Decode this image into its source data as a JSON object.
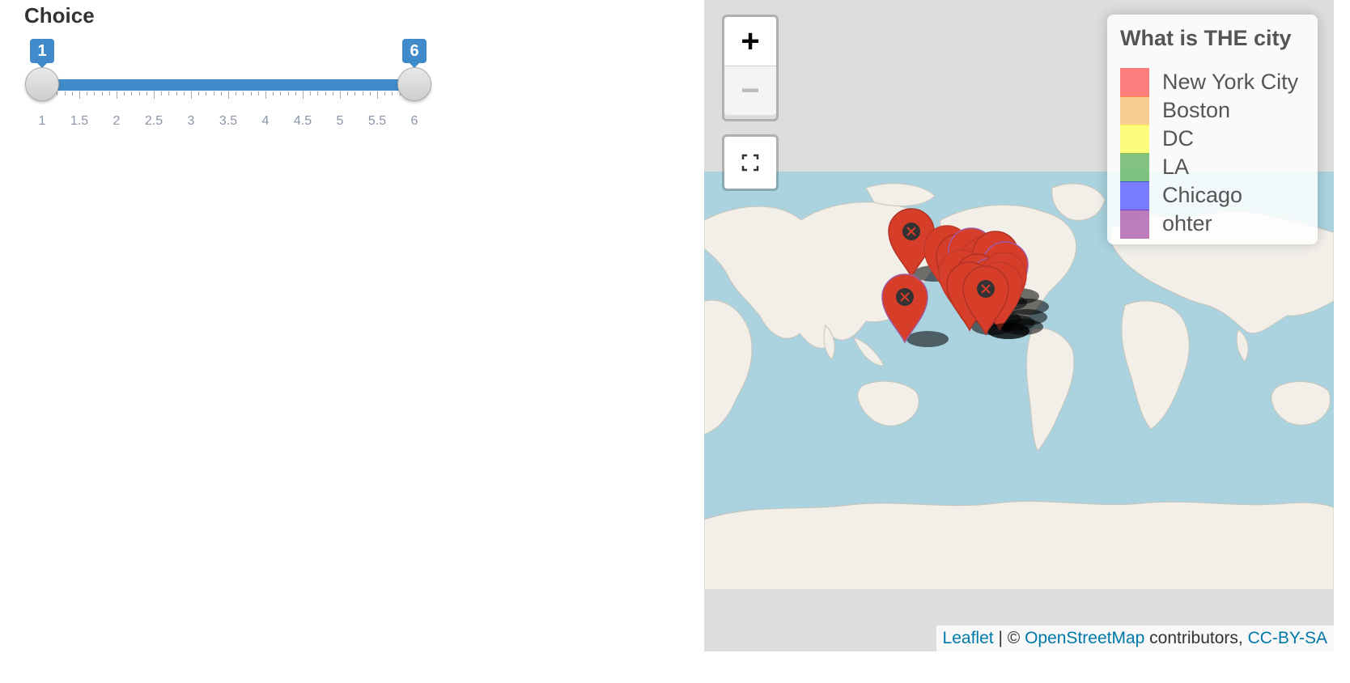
{
  "slider": {
    "label": "Choice",
    "min": 1,
    "max": 6,
    "value_from": 1,
    "value_to": 6,
    "from_label": "1",
    "to_label": "6",
    "tick_labels": [
      "1",
      "1.5",
      "2",
      "2.5",
      "3",
      "3.5",
      "4",
      "4.5",
      "5",
      "5.5",
      "6"
    ],
    "accent_color": "#428bca"
  },
  "map": {
    "zoom_in_label": "+",
    "zoom_out_label": "−",
    "fullscreen_icon": "fullscreen-icon",
    "marker_color": "#d63e2a",
    "legend": {
      "title": "What is THE city",
      "items": [
        {
          "label": "New York City",
          "color": "#ff0000"
        },
        {
          "label": "Boston",
          "color": "#f5a22e"
        },
        {
          "label": "DC",
          "color": "#ffff00"
        },
        {
          "label": "LA",
          "color": "#0a8c0a"
        },
        {
          "label": "Chicago",
          "color": "#0000ff"
        },
        {
          "label": "ohter",
          "color": "#800080"
        }
      ]
    },
    "attribution": {
      "leaflet": "Leaflet",
      "separator": "| ©",
      "osm": "OpenStreetMap",
      "contributors": "contributors,",
      "license": "CC-BY-SA"
    }
  }
}
